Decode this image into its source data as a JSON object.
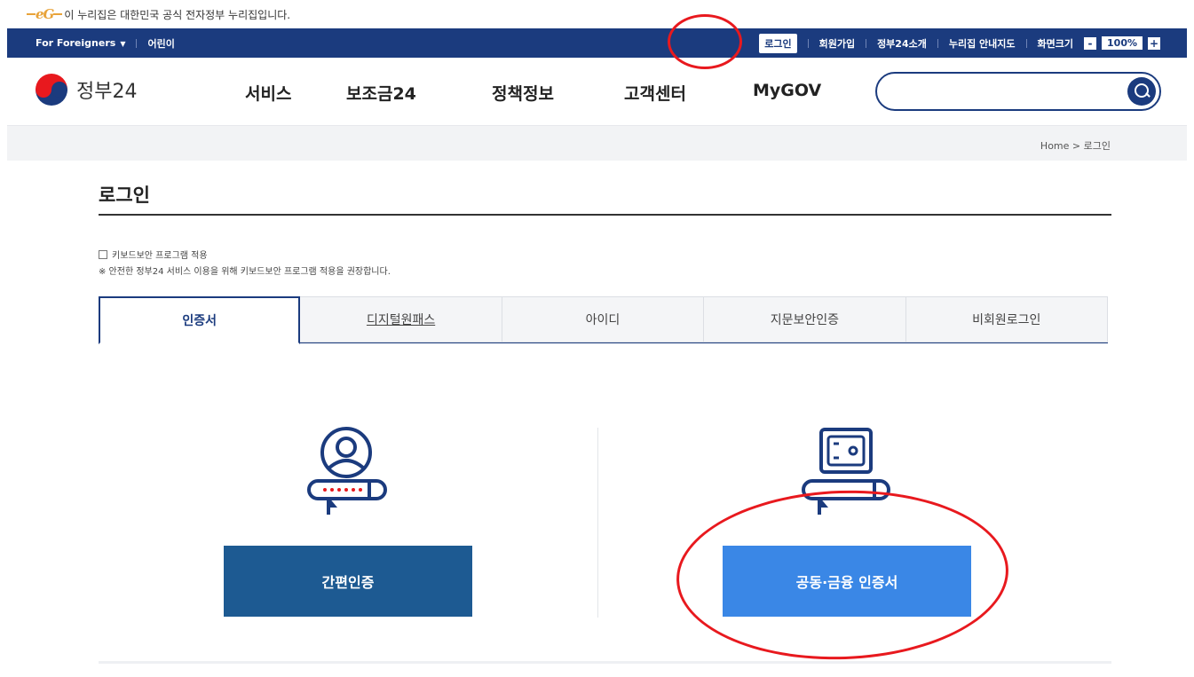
{
  "notice": {
    "logo": "eG",
    "text": "이 누리집은 대한민국 공식 전자정부 누리집입니다."
  },
  "util": {
    "foreigners": "For Foreigners",
    "kids": "어린이",
    "login": "로그인",
    "signup": "회원가입",
    "about": "정부24소개",
    "sitemap": "누리집 안내지도",
    "screen_size": "화면크기",
    "zoom_minus": "-",
    "zoom_value": "100%",
    "zoom_plus": "+"
  },
  "brand": {
    "name": "정부24"
  },
  "nav": {
    "items": [
      "서비스",
      "보조금24",
      "정책정보",
      "고객센터",
      "MyGOV"
    ]
  },
  "search": {
    "placeholder": ""
  },
  "breadcrumb": {
    "home": "Home",
    "sep": ">",
    "current": "로그인"
  },
  "page": {
    "title": "로그인",
    "kbd_label": "키보드보안 프로그램 적용",
    "kbd_note": "※ 안전한 정부24 서비스 이용을 위해 키보드보안 프로그램 적용을 권장합니다."
  },
  "tabs": [
    "인증서",
    "디지털원패스",
    "아이디",
    "지문보안인증",
    "비회원로그인"
  ],
  "panels": {
    "simple_auth": "간편인증",
    "cert": "공동·금융 인증서"
  },
  "colors": {
    "navy": "#1b3b7e",
    "primary_btn": "#1d5a92",
    "cert_btn": "#3a87e6",
    "annotation": "#e8191e"
  }
}
